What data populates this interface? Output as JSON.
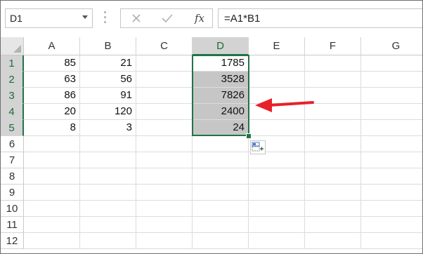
{
  "name_box": {
    "value": "D1"
  },
  "formula_bar": {
    "cancel_icon": "close-icon",
    "enter_icon": "check-icon",
    "function_label": "fx",
    "formula": "=A1*B1"
  },
  "columns": [
    "A",
    "B",
    "C",
    "D",
    "E",
    "F",
    "G"
  ],
  "rows": [
    "1",
    "2",
    "3",
    "4",
    "5",
    "6",
    "7",
    "8",
    "9",
    "10",
    "11",
    "12"
  ],
  "cells": {
    "A": [
      "85",
      "63",
      "86",
      "20",
      "8"
    ],
    "B": [
      "21",
      "56",
      "91",
      "120",
      "3"
    ],
    "D": [
      "1785",
      "3528",
      "7826",
      "2400",
      "24"
    ]
  },
  "selection": {
    "range": "D1:D5",
    "active_column": "D",
    "active_rows": [
      "1",
      "2",
      "3",
      "4",
      "5"
    ]
  },
  "annotation": {
    "arrow_color": "#e8202a",
    "arrow_target": "D column"
  },
  "colors": {
    "accent": "#217346",
    "selected_fill": "#c6c6c6"
  }
}
